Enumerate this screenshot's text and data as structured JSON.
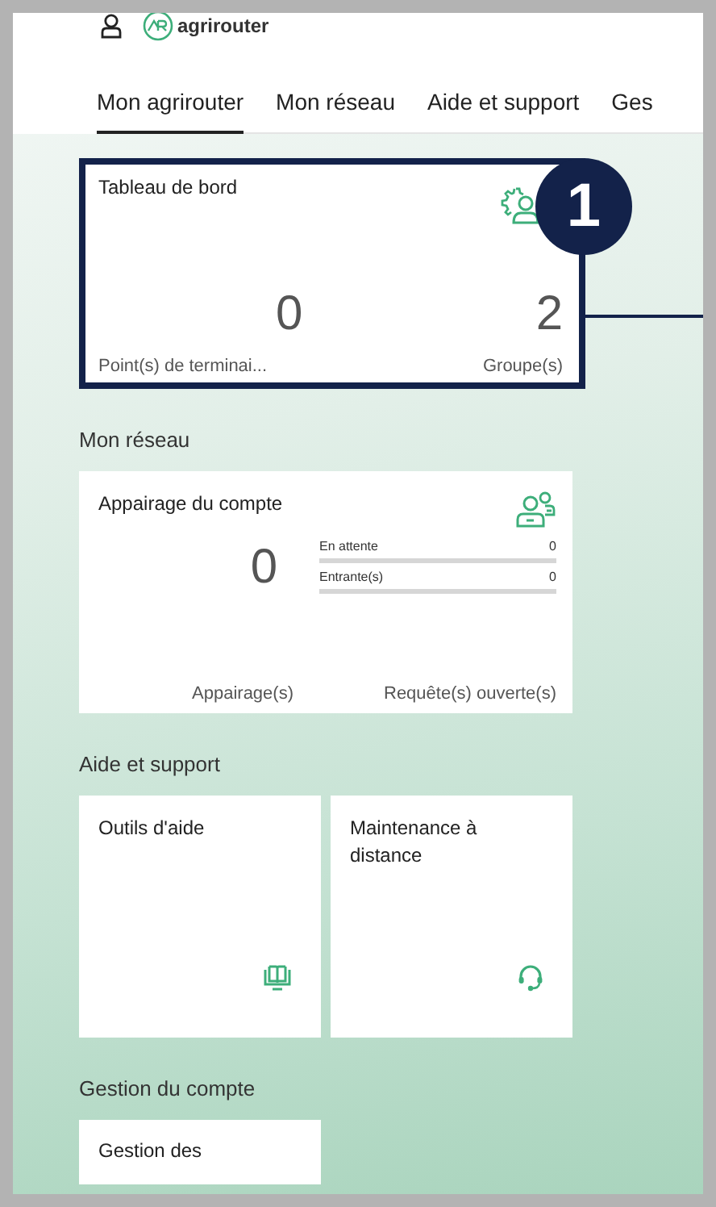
{
  "header": {
    "logo_text": "agrirouter"
  },
  "tabs": [
    {
      "label": "Mon agrirouter",
      "selected": true
    },
    {
      "label": "Mon réseau",
      "selected": false
    },
    {
      "label": "Aide et support",
      "selected": false
    },
    {
      "label": "Ges",
      "selected": false
    }
  ],
  "callout": {
    "number": "1"
  },
  "dashboard": {
    "title": "Tableau de bord",
    "highlighted": true,
    "stats": [
      {
        "value": "0",
        "label": "Point(s) de terminai..."
      },
      {
        "value": "2",
        "label": "Groupe(s)"
      }
    ]
  },
  "sections": [
    {
      "title": "Mon réseau",
      "cards": [
        {
          "kind": "pairing",
          "title": "Appairage du compte",
          "value": "0",
          "value_label": "Appairage(s)",
          "requests": [
            {
              "label": "En attente",
              "count": "0"
            },
            {
              "label": "Entrante(s)",
              "count": "0"
            }
          ],
          "requests_label": "Requête(s) ouverte(s)"
        }
      ]
    },
    {
      "title": "Aide et support",
      "cards": [
        {
          "kind": "manual",
          "title": "Outils d'aide"
        },
        {
          "kind": "remote",
          "title": "Maintenance à distance"
        }
      ]
    },
    {
      "title": "Gestion du compte",
      "cards": [
        {
          "kind": "partial",
          "title": "Gestion des"
        }
      ]
    }
  ]
}
